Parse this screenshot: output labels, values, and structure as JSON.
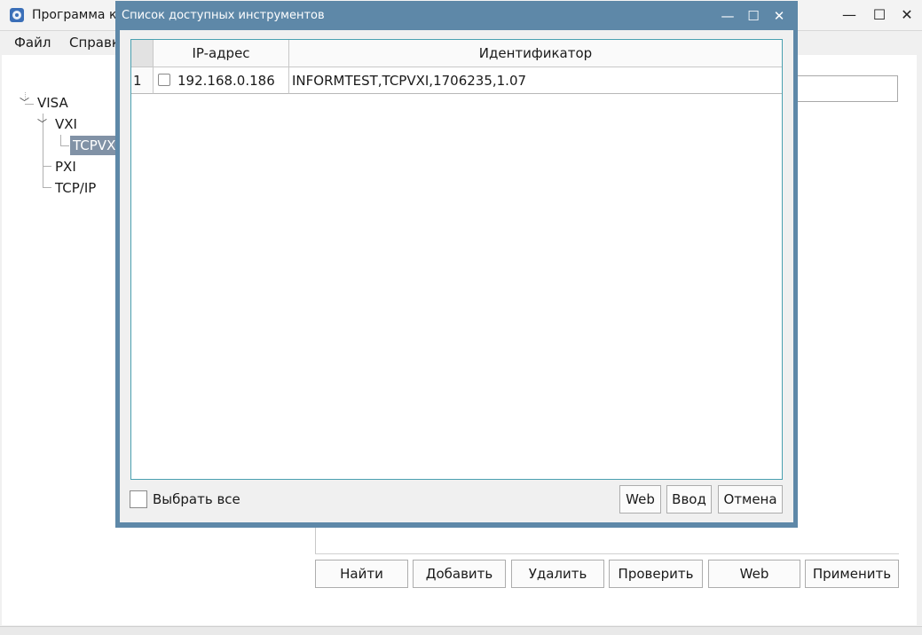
{
  "main_window": {
    "title": "Программа кон",
    "menu": [
      "Файл",
      "Справк"
    ],
    "tree": {
      "root": "VISA",
      "vxi": "VXI",
      "tcpvxi": "TCPVX",
      "pxi": "PXI",
      "tcpip": "TCP/IP"
    },
    "buttons": {
      "find": "Найти",
      "add": "Добавить",
      "delete": "Удалить",
      "check": "Проверить",
      "web": "Web",
      "apply": "Применить"
    }
  },
  "dialog": {
    "title": "Список доступных инструментов",
    "table": {
      "columns": [
        "IP-адрес",
        "Идентификатор"
      ],
      "rows": [
        {
          "num": "1",
          "ip": "192.168.0.186",
          "id": "INFORMTEST,TCPVXI,1706235,1.07",
          "checked": false
        }
      ]
    },
    "select_all_label": "Выбрать все",
    "buttons": {
      "web": "Web",
      "enter": "Ввод",
      "cancel": "Отмена"
    }
  },
  "icons": {
    "min": "—",
    "max": "☐",
    "close": "✕"
  },
  "colors": {
    "dialog_frame": "#5e88a8",
    "table_border": "#4aa0b0",
    "tree_selected": "#8192a6"
  }
}
